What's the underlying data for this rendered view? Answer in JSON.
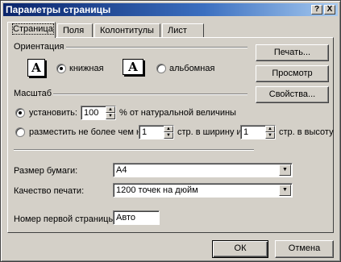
{
  "window": {
    "title": "Параметры страницы",
    "help_button": "?",
    "close_button": "X"
  },
  "tabs": [
    {
      "label": "Страница"
    },
    {
      "label": "Поля"
    },
    {
      "label": "Колонтитулы"
    },
    {
      "label": "Лист"
    }
  ],
  "orientation": {
    "group_label": "Ориентация",
    "portrait_label": "книжная",
    "landscape_label": "альбомная",
    "icon_glyph": "A",
    "selected": "portrait"
  },
  "scale": {
    "group_label": "Масштаб",
    "set_label": "установить:",
    "set_value": "100",
    "set_suffix": "% от натуральной величины",
    "fit_label": "разместить не более чем на:",
    "fit_wide_value": "1",
    "fit_wide_suffix": "стр. в ширину и",
    "fit_tall_value": "1",
    "fit_tall_suffix": "стр. в высоту",
    "selected": "set"
  },
  "paper": {
    "size_label": "Размер бумаги:",
    "size_value": "A4",
    "quality_label": "Качество печати:",
    "quality_value": "1200 точек на дюйм",
    "first_page_label": "Номер первой страницы:",
    "first_page_value": "Авто"
  },
  "side_buttons": {
    "print": "Печать...",
    "preview": "Просмотр",
    "properties": "Свойства..."
  },
  "footer": {
    "ok": "ОК",
    "cancel": "Отмена"
  }
}
